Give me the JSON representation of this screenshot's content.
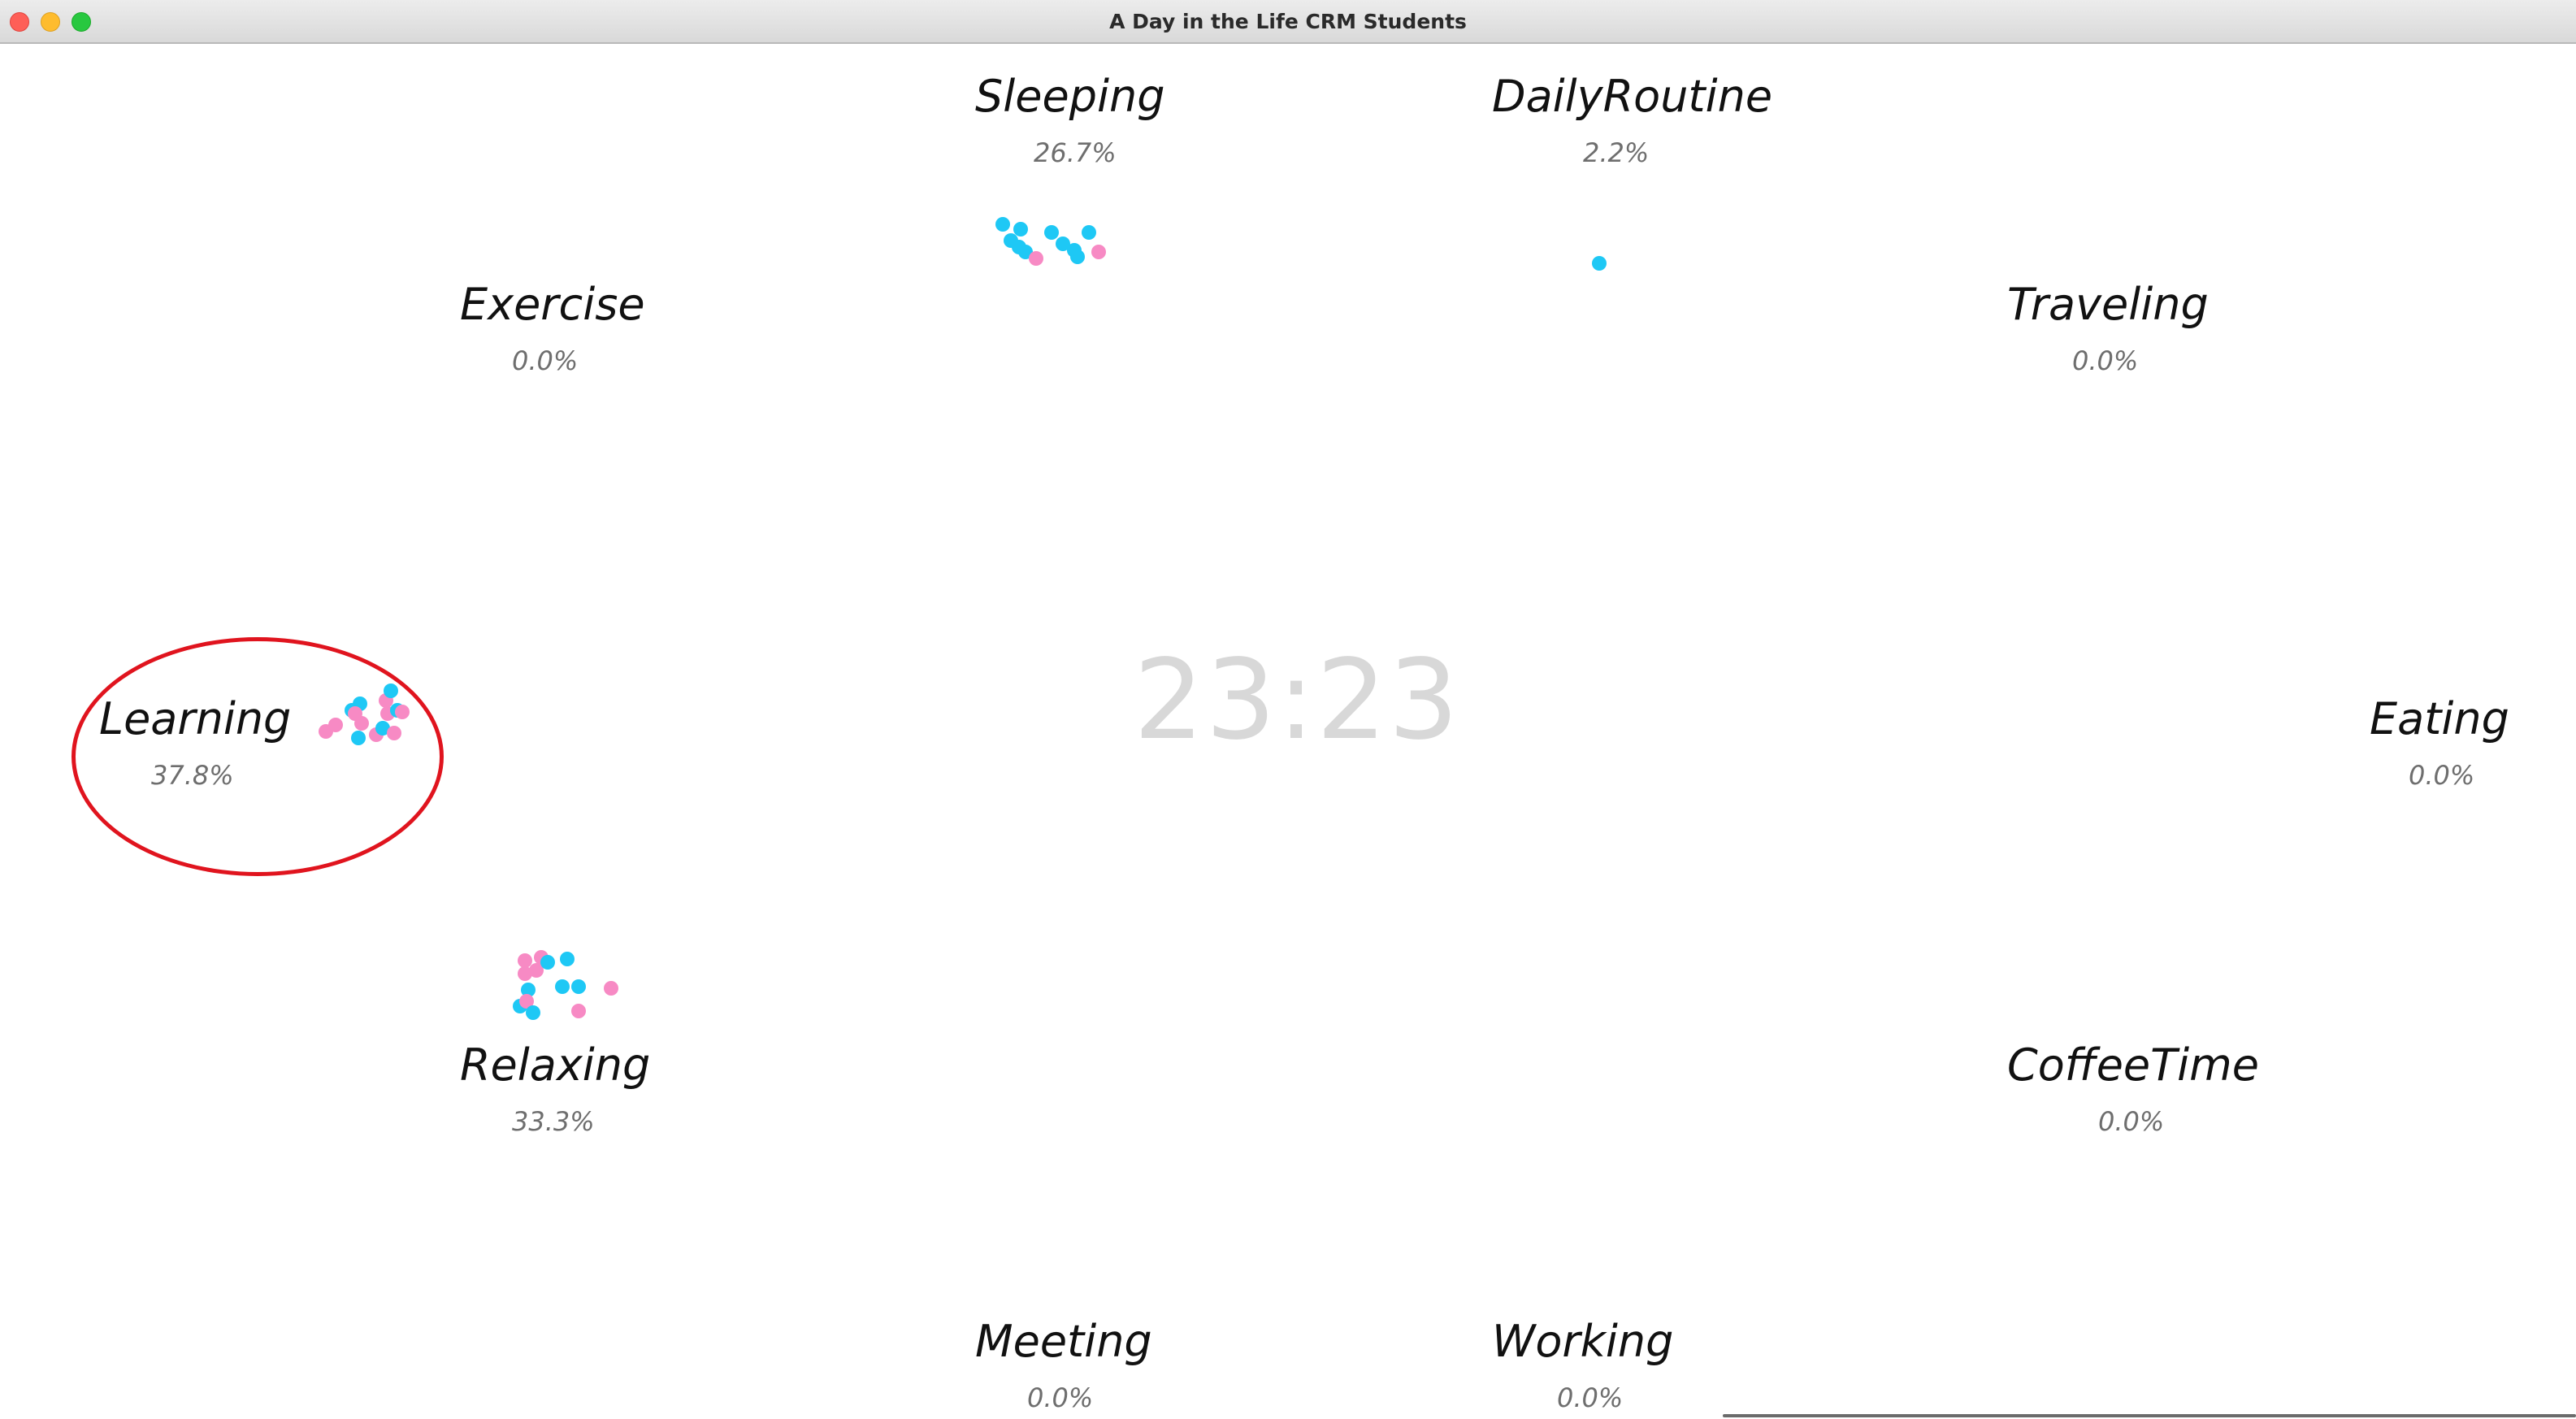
{
  "window": {
    "title": "A Day in the Life CRM Students"
  },
  "clock": {
    "time": "23:23"
  },
  "colors": {
    "group_a": "#1ec8f5",
    "group_b": "#f78ac4",
    "highlight": "#e0141e",
    "clock": "#d8d8d8",
    "percent": "#6e6e6e"
  },
  "activities": {
    "sleeping": {
      "name": "Sleeping",
      "percent": "26.7%"
    },
    "dailyroutine": {
      "name": "DailyRoutine",
      "percent": "2.2%"
    },
    "exercise": {
      "name": "Exercise",
      "percent": "0.0%"
    },
    "traveling": {
      "name": "Traveling",
      "percent": "0.0%"
    },
    "learning": {
      "name": "Learning",
      "percent": "37.8%"
    },
    "eating": {
      "name": "Eating",
      "percent": "0.0%"
    },
    "relaxing": {
      "name": "Relaxing",
      "percent": "33.3%"
    },
    "coffeetime": {
      "name": "CoffeeTime",
      "percent": "0.0%"
    },
    "meeting": {
      "name": "Meeting",
      "percent": "0.0%"
    },
    "working": {
      "name": "Working",
      "percent": "0.0%"
    }
  },
  "annotations": {
    "highlighted_activity": "learning"
  }
}
